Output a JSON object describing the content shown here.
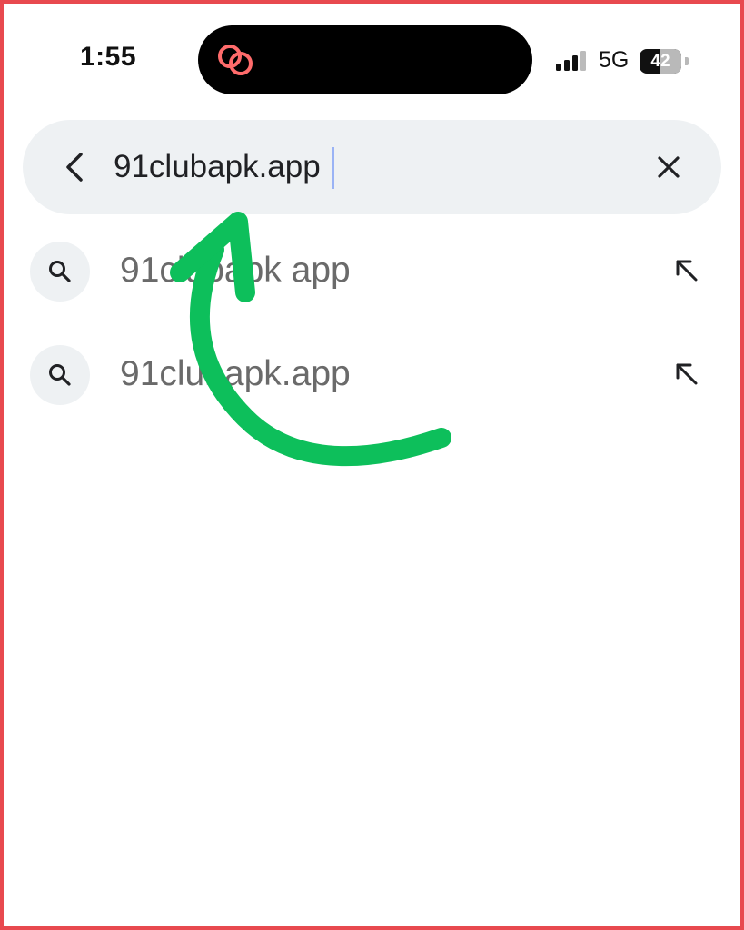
{
  "status_bar": {
    "time": "1:55",
    "network": "5G",
    "battery": "42",
    "island_icon": "link-rings-icon"
  },
  "search": {
    "value": "91clubapk.app",
    "back_icon": "chevron-left-icon",
    "clear_icon": "close-icon"
  },
  "suggestions": [
    {
      "text": "91clubapk app",
      "icon": "search-icon",
      "action_icon": "arrow-up-left-icon"
    },
    {
      "text": "91clubapk.app",
      "icon": "search-icon",
      "action_icon": "arrow-up-left-icon"
    }
  ],
  "annotation": {
    "color": "#0dbf5b",
    "shape": "curved-arrow"
  },
  "colors": {
    "frame": "#e8494f",
    "search_bg": "#eef1f3",
    "island_icon": "#ff6b6b"
  }
}
